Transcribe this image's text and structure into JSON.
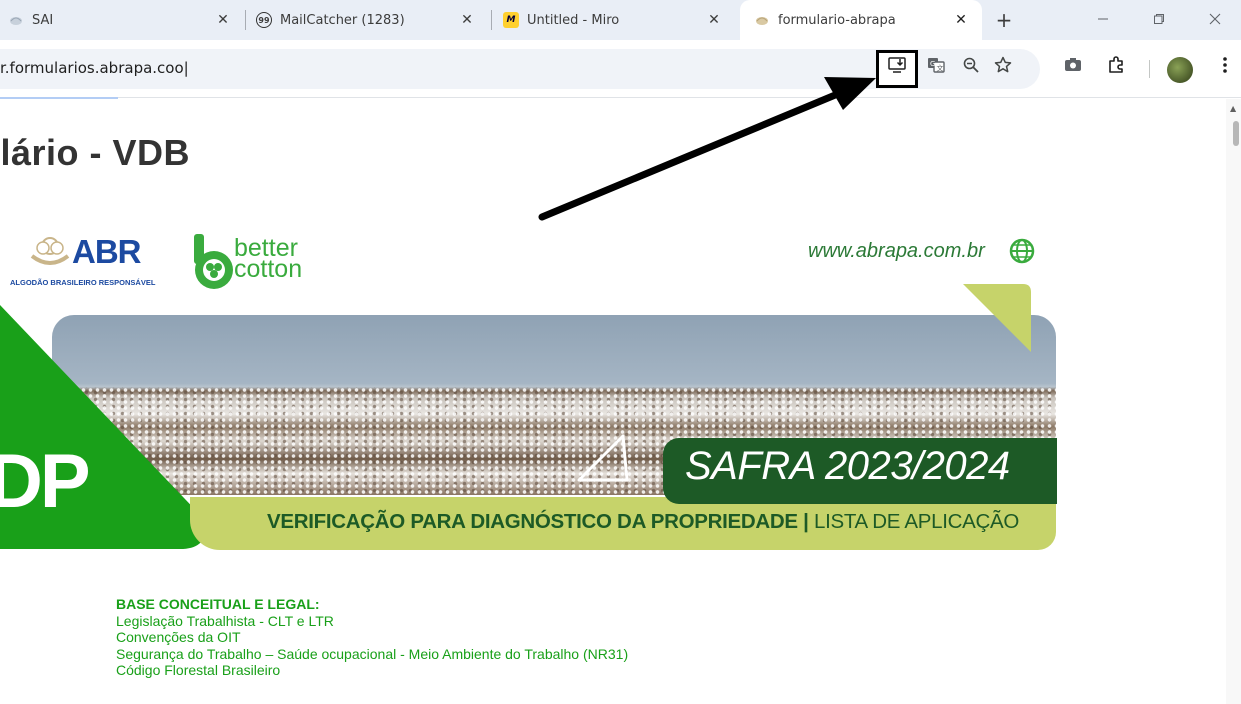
{
  "browser": {
    "tabs": [
      {
        "title": "SAI",
        "favicon": "sai-favicon",
        "active": false
      },
      {
        "title": "MailCatcher (1283)",
        "favicon": "99",
        "active": false
      },
      {
        "title": "Untitled - Miro",
        "favicon": "miro-favicon",
        "active": false
      },
      {
        "title": "formulario-abrapa",
        "favicon": "abrapa-favicon",
        "active": true
      }
    ],
    "new_tab_label": "+",
    "url": "r.formularios.abrapa.coo|",
    "toolbar_icons": [
      "install-app-icon",
      "translate-icon",
      "zoom-out-icon",
      "bookmark-star-icon",
      "screenshot-icon",
      "extensions-icon",
      "profile-avatar",
      "more-menu-icon"
    ],
    "window_controls": [
      "minimize-icon",
      "restore-icon",
      "close-icon"
    ]
  },
  "page": {
    "title": "ılário - VDB",
    "banner": {
      "abr_text": "ABR",
      "abr_subtitle": "ALGODÃO BRASILEIRO RESPONSÁVEL",
      "better_cotton_line1": "better",
      "better_cotton_line2": "cotton",
      "website": "www.abrapa.com.br",
      "safra": "SAFRA 2023/2024",
      "subtitle_bold": "VERIFICAÇÃO PARA DIAGNÓSTICO DA PROPRIEDADE |",
      "subtitle_light": " LISTA DE APLICAÇÃO",
      "side_letters": "DP"
    },
    "base": {
      "heading": "BASE CONCEITUAL E LEGAL:",
      "items": [
        "Legislação Trabalhista - CLT e LTR",
        "Convenções da OIT",
        "Segurança do Trabalho – Saúde ocupacional - Meio Ambiente do Trabalho (NR31)",
        "Código Florestal Brasileiro"
      ]
    }
  },
  "colors": {
    "brand_green": "#19a019",
    "dark_green": "#1d5a26",
    "lime": "#c6d36a",
    "abr_blue": "#1c4aa1",
    "annotation_arrow": "#000000"
  }
}
